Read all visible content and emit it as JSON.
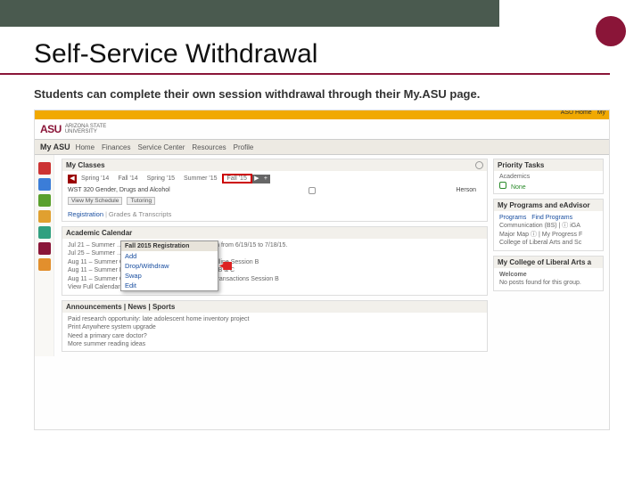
{
  "slide": {
    "title": "Self-Service Withdrawal",
    "subtitle": "Students can complete their own session withdrawal through their My.ASU page."
  },
  "asu_header": {
    "logo_main": "ASU",
    "logo_sub1": "ARIZONA STATE",
    "logo_sub2": "UNIVERSITY",
    "top_links": [
      "ASU Home",
      "My"
    ]
  },
  "navbar": {
    "brand": "My ASU",
    "tabs": [
      "Home",
      "Finances",
      "Service Center",
      "Resources",
      "Profile"
    ]
  },
  "classes_panel": {
    "title": "My Classes",
    "prev": "◀",
    "next": "▶",
    "plus": "+",
    "terms": [
      "Spring '14",
      "Fall '14",
      "Spring '15",
      "Summer '15",
      "Fall '15"
    ],
    "selected_term_index": 4,
    "class_row": {
      "code": "WST 320 Gender, Drugs and Alcohol",
      "instructor": "Herson"
    },
    "view_schedule": "View My Schedule",
    "tutoring": "Tutoring"
  },
  "registration": {
    "label": "Registration",
    "menu_header": "Fall 2015 Registration",
    "items": [
      "Add",
      "Drop/Withdraw",
      "Swap",
      "Edit"
    ],
    "highlight_index": 1,
    "grades": "Grades & Transcripts"
  },
  "calendar": {
    "title": "Academic Calendar",
    "lines": [
      "Jul 21 – Summer …  Payment Deadline  For registration from 6/19/15 to 7/18/15.",
      "Jul 25 – Summer …",
      "Aug 11 – Summer Complete Session Withdrawal Deadline Session B",
      "Aug 11 – Summer Degree Conferral Date Sessions A, B & C",
      "Aug 11 – Summer Classes End/Last Day to Process Transactions Session B"
    ],
    "view_full": "View Full Calendar"
  },
  "announcements": {
    "title": "Announcements | News | Sports",
    "lines": [
      "Paid research opportunity: late adolescent home inventory project",
      "Print Anywhere system upgrade",
      "Need a primary care doctor?",
      "More summer reading ideas"
    ]
  },
  "side_tasks": {
    "title": "Priority Tasks",
    "section": "Academics",
    "none": "None"
  },
  "side_programs": {
    "title": "My Programs and eAdvisor",
    "tab_a": "Programs",
    "tab_b": "Find Programs",
    "lines": [
      "Communication (BS) | ⓘ iGA",
      "Major Map ⓘ | My Progress F",
      "College of Liberal Arts and Sc"
    ]
  },
  "side_college": {
    "title": "My College of Liberal Arts a",
    "welcome": "Welcome",
    "msg": "No posts found for this group."
  },
  "icon_colors": [
    "#c33",
    "#3b7dd8",
    "#5aa02c",
    "#e0a030",
    "#30a080",
    "#8a1538",
    "#e28f2d",
    "#5a5a5a"
  ]
}
